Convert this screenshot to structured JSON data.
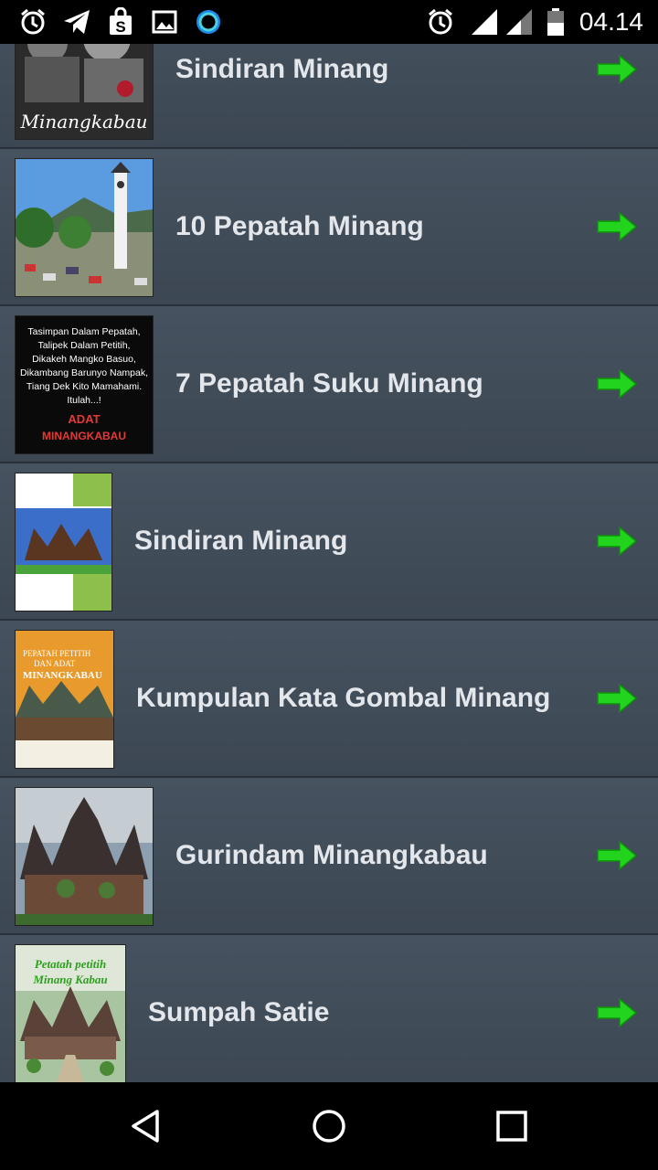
{
  "status_bar": {
    "time": "04.14",
    "left_icons": [
      "alarm-icon",
      "telegram-icon",
      "shopping-bag-icon",
      "image-icon",
      "circle-app-icon"
    ],
    "right_icons": [
      "alarm-icon",
      "signal-icon",
      "signal-weak-icon",
      "battery-icon"
    ]
  },
  "list": {
    "items": [
      {
        "label": "Sindiran Minang",
        "thumb_text": "Minangkabau"
      },
      {
        "label": "10 Pepatah Minang"
      },
      {
        "label": "7 Pepatah Suku Minang",
        "thumb_lines": [
          "Tasimpan Dalam Pepatah,",
          "Talipek Dalam Petitih,",
          "Dikakeh Mangko Basuo,",
          "Dikambang Barunyo Nampak,",
          "Tiang Dek Kito Mamahami.",
          "Itulah...!",
          "ADAT",
          "MINANGKABAU"
        ]
      },
      {
        "label": "Sindiran Minang"
      },
      {
        "label": "Kumpulan Kata Gombal Minang",
        "thumb_lines": [
          "PEPATAH PETITIH",
          "DAN ADAT",
          "MINANGKABAU"
        ]
      },
      {
        "label": "Gurindam Minangkabau"
      },
      {
        "label": "Sumpah Satie",
        "thumb_lines": [
          "Petatah petitih",
          "Minang Kabau"
        ]
      }
    ]
  },
  "colors": {
    "list_bg": "#3f4b58",
    "arrow": "#22d41e",
    "label": "#e3e6ea"
  },
  "nav_bar": {
    "buttons": [
      "back-icon",
      "home-icon",
      "recents-icon"
    ]
  }
}
